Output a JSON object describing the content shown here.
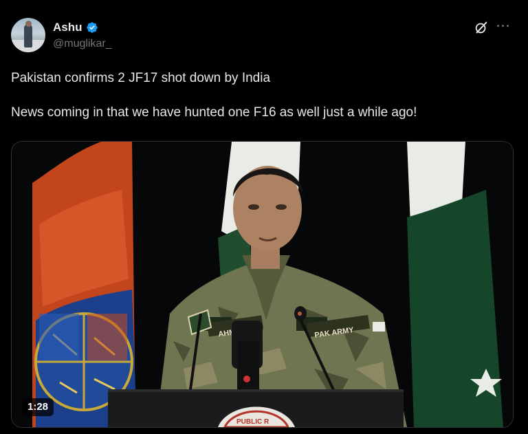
{
  "author": {
    "name": "Ashu",
    "handle": "@muglikar_",
    "verified": true,
    "verified_color": "#1d9bf0"
  },
  "header_icons": [
    "grok-icon",
    "more-options-icon"
  ],
  "more_label": "···",
  "tweet": {
    "lines": [
      "Pakistan confirms 2 JF17 shot down by India",
      "News coming in that we have hunted one F16 as well just a while ago!"
    ]
  },
  "video": {
    "duration": "1:28",
    "uniform_patches": [
      "AHMED",
      "PAK ARMY"
    ],
    "podium_seal_text": "PUBLIC R"
  },
  "colors": {
    "background": "#000000",
    "text": "#e7e9ea",
    "muted": "#71767b"
  }
}
